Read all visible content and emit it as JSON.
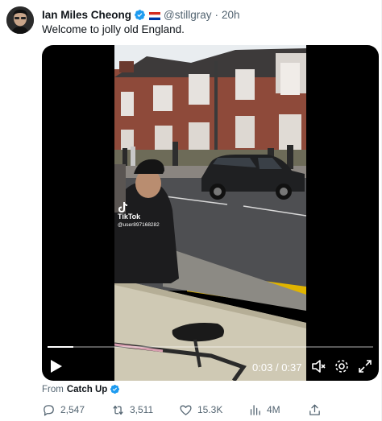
{
  "author": {
    "display_name": "Ian Miles Cheong",
    "handle": "@stillgray",
    "time": "20h",
    "separator": "·"
  },
  "tweet": {
    "text": "Welcome to jolly old England."
  },
  "video": {
    "watermark": "TikTok",
    "watermark_user": "@user897168282",
    "current_time": "0:03",
    "duration": "0:37",
    "time_separator": "/",
    "progress_fraction": 0.08
  },
  "source": {
    "from_label": "From",
    "name": "Catch Up"
  },
  "actions": {
    "replies": "2,547",
    "reposts": "3,511",
    "likes": "15.3K",
    "views": "4M"
  },
  "colors": {
    "verified": "#1d9bf0",
    "text_primary": "#0f1419",
    "text_secondary": "#536471",
    "video_bg": "#000000"
  },
  "icons": [
    "verified-icon",
    "flag-icon",
    "play-icon",
    "mute-icon",
    "settings-icon",
    "fullscreen-icon",
    "reply-icon",
    "repost-icon",
    "like-icon",
    "views-icon",
    "share-icon"
  ]
}
